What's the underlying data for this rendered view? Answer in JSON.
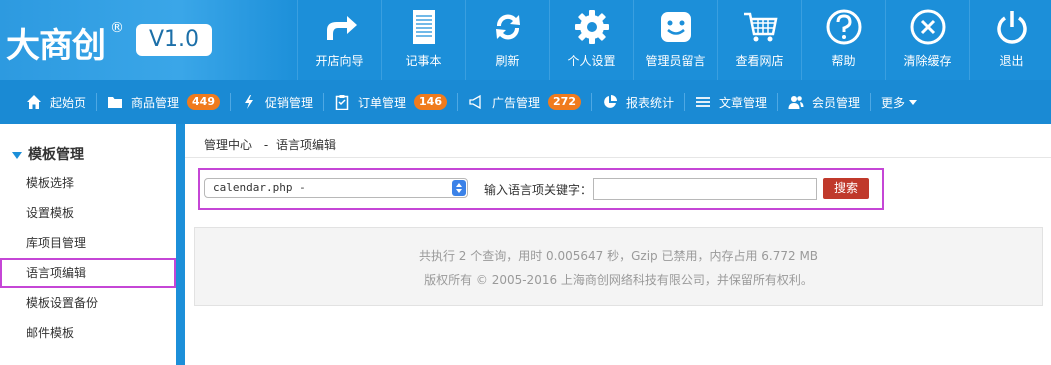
{
  "brand": {
    "logo_text": "大商创",
    "registered": "®",
    "version": "V1.0"
  },
  "topnav": [
    {
      "label": "开店向导",
      "icon": "share-arrow-icon"
    },
    {
      "label": "记事本",
      "icon": "notepad-icon"
    },
    {
      "label": "刷新",
      "icon": "refresh-icon"
    },
    {
      "label": "个人设置",
      "icon": "gear-icon"
    },
    {
      "label": "管理员留言",
      "icon": "smiley-message-icon"
    },
    {
      "label": "查看网店",
      "icon": "cart-icon"
    },
    {
      "label": "帮助",
      "icon": "help-icon"
    },
    {
      "label": "清除缓存",
      "icon": "clear-icon"
    },
    {
      "label": "退出",
      "icon": "power-icon"
    }
  ],
  "subnav": [
    {
      "label": "起始页",
      "icon": "home-icon"
    },
    {
      "label": "商品管理",
      "icon": "folder-icon",
      "badge": "449"
    },
    {
      "label": "促销管理",
      "icon": "lightning-icon"
    },
    {
      "label": "订单管理",
      "icon": "clipboard-icon",
      "badge": "146"
    },
    {
      "label": "广告管理",
      "icon": "megaphone-icon",
      "badge": "272"
    },
    {
      "label": "报表统计",
      "icon": "pie-chart-icon"
    },
    {
      "label": "文章管理",
      "icon": "list-icon"
    },
    {
      "label": "会员管理",
      "icon": "users-icon"
    },
    {
      "label": "更多",
      "icon": "caret-down-icon"
    }
  ],
  "sidebar": {
    "heading": "模板管理",
    "items": [
      {
        "label": "模板选择"
      },
      {
        "label": "设置模板"
      },
      {
        "label": "库项目管理"
      },
      {
        "label": "语言项编辑",
        "active": true
      },
      {
        "label": "模板设置备份"
      },
      {
        "label": "邮件模板"
      }
    ]
  },
  "breadcrumb": {
    "root": "管理中心",
    "separator": "-",
    "current": "语言项编辑"
  },
  "search": {
    "file_select_value": "calendar.php -",
    "keyword_label": "输入语言项关键字：",
    "keyword_value": "",
    "button_label": "搜索"
  },
  "footer": {
    "stats": "共执行 2 个查询，用时 0.005647 秒，Gzip 已禁用，内存占用 6.772 MB",
    "copyright": "版权所有 © 2005-2016 上海商创网络科技有限公司，并保留所有权利。"
  },
  "colors": {
    "topbar": "#1c8fd9",
    "subnav": "#1a8ad4",
    "badge": "#f07b1d",
    "highlight": "#c546d6",
    "search_button": "#c0392b"
  }
}
